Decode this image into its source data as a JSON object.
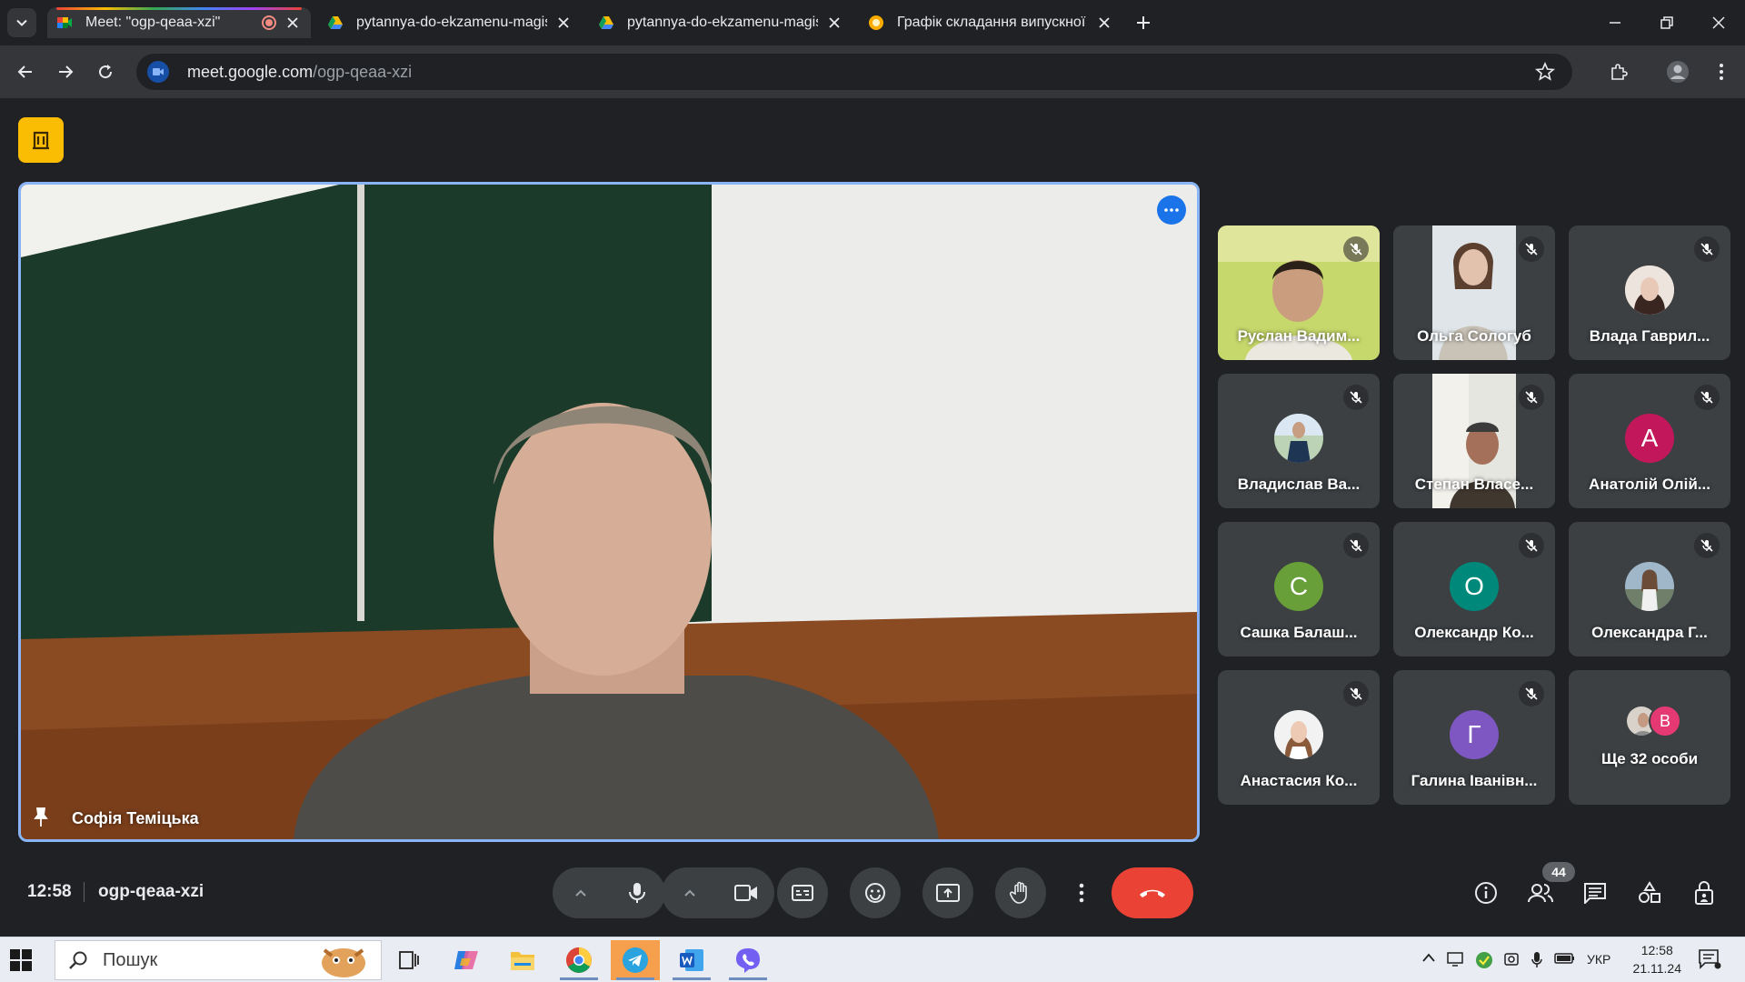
{
  "browser": {
    "tabs": [
      {
        "title": "Meet: \"ogp-qeaa-xzi\"",
        "active": true,
        "recording": true
      },
      {
        "title": "pytannya-do-ekzamenu-magist",
        "active": false
      },
      {
        "title": "pytannya-do-ekzamenu-magist",
        "active": false
      },
      {
        "title": "Графік складання випускної ат",
        "active": false
      }
    ],
    "url_host": "meet.google.com",
    "url_path": "/ogp-qeaa-xzi"
  },
  "meeting": {
    "main_speaker": "Софія Теміцька",
    "participants": [
      {
        "name": "Руслан Вадим...",
        "type": "video",
        "muted": true
      },
      {
        "name": "Ольга Сологуб",
        "type": "video",
        "muted": true
      },
      {
        "name": "Влада Гаврил...",
        "type": "photo",
        "muted": true
      },
      {
        "name": "Владислав Ва...",
        "type": "photo",
        "muted": true
      },
      {
        "name": "Степан Власе...",
        "type": "video",
        "muted": true
      },
      {
        "name": "Анатолій Олій...",
        "type": "letter",
        "letter": "А",
        "color": "#c2185b",
        "muted": true
      },
      {
        "name": "Сашка Балаш...",
        "type": "letter",
        "letter": "С",
        "color": "#689f38",
        "muted": true
      },
      {
        "name": "Олександр Ко...",
        "type": "letter",
        "letter": "О",
        "color": "#00897b",
        "muted": true
      },
      {
        "name": "Олександра Г...",
        "type": "photo",
        "muted": true
      },
      {
        "name": "Анастасия Ко...",
        "type": "photo",
        "muted": true
      },
      {
        "name": "Галина Іванівн...",
        "type": "letter",
        "letter": "Г",
        "color": "#7e57c2",
        "muted": true
      },
      {
        "name": "Ще 32 особи",
        "type": "more",
        "letter": "В",
        "color": "#e53973"
      }
    ],
    "time": "12:58",
    "code": "ogp-qeaa-xzi",
    "participant_count": "44"
  },
  "taskbar": {
    "search_placeholder": "Пошук",
    "language": "УКР",
    "time": "12:58",
    "date": "21.11.24"
  },
  "colors": {
    "accent": "#8ab4f8",
    "end_call": "#ea4335",
    "meet_logo": "#fbbc04"
  }
}
